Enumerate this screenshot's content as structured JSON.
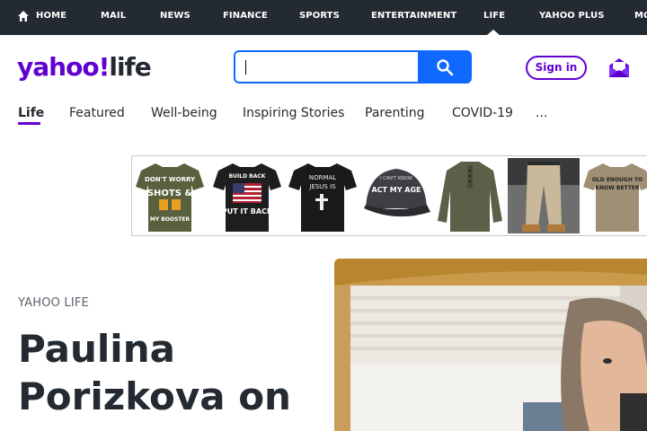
{
  "topnav": {
    "items": [
      "HOME",
      "MAIL",
      "NEWS",
      "FINANCE",
      "SPORTS",
      "ENTERTAINMENT",
      "LIFE",
      "YAHOO PLUS",
      "MO"
    ],
    "active": "LIFE"
  },
  "header": {
    "logo_yahoo": "yahoo",
    "logo_bang": "!",
    "logo_life": "life",
    "search_placeholder": "",
    "signin_label": "Sign in"
  },
  "subnav": {
    "tabs": [
      "Life",
      "Featured",
      "Well-being",
      "Inspiring Stories",
      "Parenting",
      "COVID-19",
      "..."
    ],
    "active": "Life"
  },
  "ad": {
    "tiles": [
      {
        "lines": [
          "DON'T WORRY",
          "SHOTS &",
          "MY BOOSTER"
        ]
      },
      {
        "lines": [
          "BUILD BACK",
          "PUT IT BACK"
        ]
      },
      {
        "lines": [
          "NORMAL",
          "JESUS IS"
        ]
      },
      {
        "lines": [
          "I CAN'T KNOW",
          "ACT MY AGE"
        ]
      },
      {
        "lines": []
      },
      {
        "lines": []
      },
      {
        "lines": [
          "OLD ENOUGH TO",
          "KNOW BETTER"
        ]
      }
    ]
  },
  "article": {
    "kicker": "YAHOO LIFE",
    "headline": "Paulina Porizkova on"
  },
  "colors": {
    "brand_purple": "#6001d2",
    "topnav_bg": "#232a31",
    "search_blue": "#0f69ff"
  }
}
